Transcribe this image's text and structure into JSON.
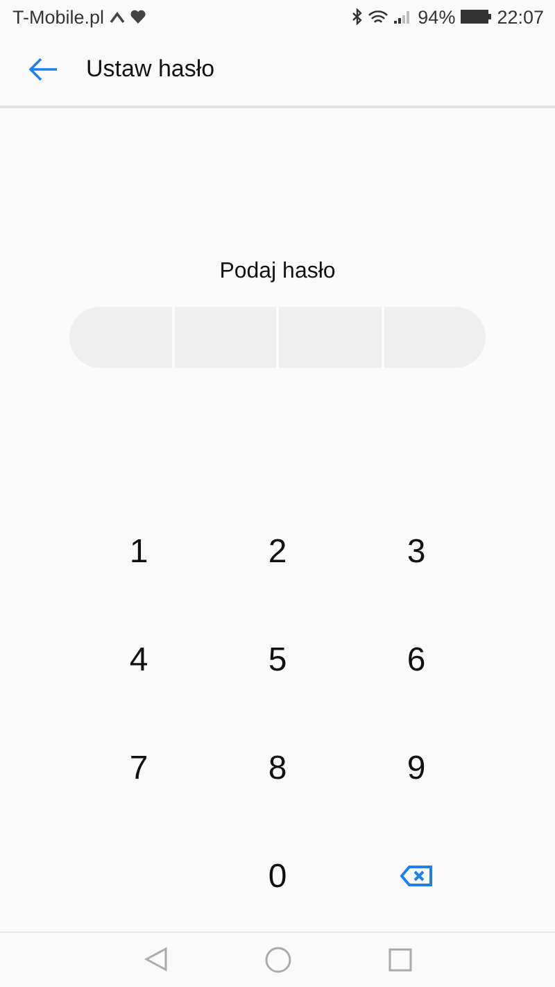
{
  "status_bar": {
    "carrier": "T-Mobile.pl",
    "battery": "94%",
    "time": "22:07"
  },
  "header": {
    "title": "Ustaw hasło"
  },
  "prompt": "Podaj hasło",
  "pin_slots": [
    {
      "filled": false
    },
    {
      "filled": false
    },
    {
      "filled": false
    },
    {
      "filled": false
    }
  ],
  "keypad": [
    {
      "kind": "digit",
      "label": "1"
    },
    {
      "kind": "digit",
      "label": "2"
    },
    {
      "kind": "digit",
      "label": "3"
    },
    {
      "kind": "digit",
      "label": "4"
    },
    {
      "kind": "digit",
      "label": "5"
    },
    {
      "kind": "digit",
      "label": "6"
    },
    {
      "kind": "digit",
      "label": "7"
    },
    {
      "kind": "digit",
      "label": "8"
    },
    {
      "kind": "digit",
      "label": "9"
    },
    {
      "kind": "empty"
    },
    {
      "kind": "digit",
      "label": "0"
    },
    {
      "kind": "backspace"
    }
  ]
}
